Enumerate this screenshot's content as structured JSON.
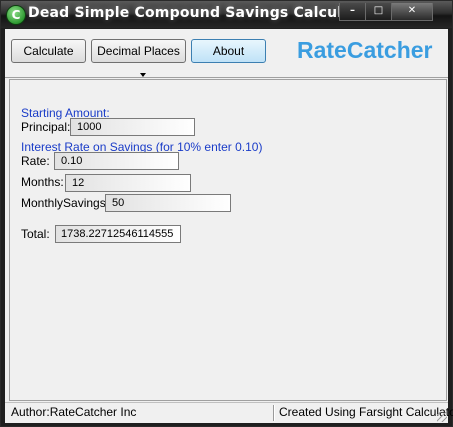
{
  "window": {
    "title": "Dead Simple Compound Savings Calculator",
    "icon_letter": "C",
    "controls": {
      "min": "–",
      "max": "□",
      "close": "✕"
    }
  },
  "toolbar": {
    "calculate_label": "Calculate",
    "decimal_places_label": "Decimal Places",
    "about_label": "About",
    "logo_text": "RateCatcher"
  },
  "form": {
    "starting_amount_heading": "Starting Amount:",
    "principal_label": "Principal:",
    "principal_value": "1000",
    "interest_heading": "Interest Rate on Savings (for 10% enter 0.10)",
    "rate_label": "Rate:",
    "rate_value": "0.10",
    "months_label": "Months:",
    "months_value": "12",
    "monthly_savings_label": "MonthlySavings:",
    "monthly_savings_value": "50",
    "total_label": "Total:",
    "total_value": "1738.22712546114555"
  },
  "statusbar": {
    "author": "Author:RateCatcher Inc",
    "created_with": "Created Using Farsight Calculator"
  },
  "colors": {
    "logo": "#3a9de0",
    "heading_blue": "#1a3cc8",
    "about_button": "#bfe2f7"
  }
}
